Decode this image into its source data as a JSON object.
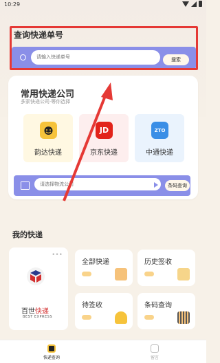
{
  "status_bar": {
    "time": "10:29"
  },
  "query": {
    "title": "查询快递单号",
    "placeholder": "请输入快递单号",
    "search_label": "搜索"
  },
  "common_companies": {
    "title": "常用快递公司",
    "subtitle": "多家快递公司·等你选择",
    "items": [
      {
        "name": "韵达快递",
        "logo_icon": "yunda-logo-icon",
        "logo_text": "",
        "color": "#f6c33b"
      },
      {
        "name": "京东快递",
        "logo_icon": "jd-logo-icon",
        "logo_text": "JD",
        "color": "#e2231a"
      },
      {
        "name": "中通快递",
        "logo_icon": "zto-logo-icon",
        "logo_text": "ZTO",
        "color": "#3a8ee6"
      }
    ]
  },
  "barcode": {
    "placeholder": "请选择物流公司",
    "button_label": "条码查询"
  },
  "mine": {
    "title": "我的快递",
    "best": {
      "name_left": "百世",
      "name_right": "快递",
      "english": "BEST EXPRESS",
      "dots": "•••"
    },
    "tiles": [
      {
        "label": "全部快递",
        "icon": "box-icon",
        "color": "#f6c27a"
      },
      {
        "label": "历史签收",
        "icon": "clipboard-icon",
        "color": "#f6d58a"
      },
      {
        "label": "待签收",
        "icon": "bell-icon",
        "color": "#f6c33b"
      },
      {
        "label": "条码查询",
        "icon": "barcode-icon",
        "color": "#f6c27a"
      }
    ]
  },
  "tabs": [
    {
      "label": "快递查询",
      "icon": "parcel-tab-icon",
      "active": true
    },
    {
      "label": "留言",
      "icon": "message-tab-icon",
      "active": false
    }
  ],
  "colors": {
    "accent": "#8a8fe8",
    "highlight": "#e53935",
    "brand_yellow": "#f6c33b"
  }
}
